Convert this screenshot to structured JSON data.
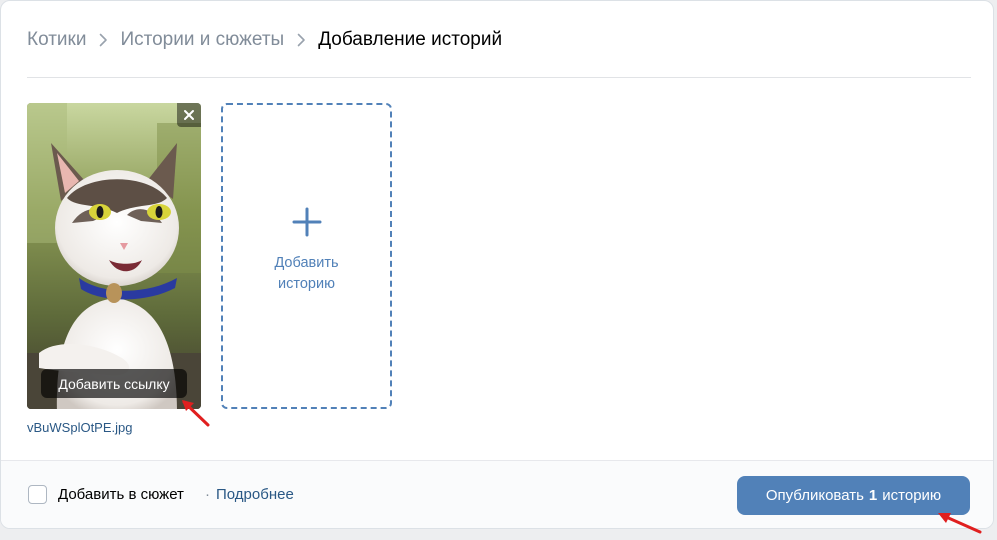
{
  "breadcrumb": {
    "items": [
      "Котики",
      "Истории и сюжеты"
    ],
    "current": "Добавление историй"
  },
  "story": {
    "filename": "vBuWSplOtPE.jpg",
    "add_link_label": "Добавить ссылку",
    "close_icon": "close-icon"
  },
  "add_story": {
    "line1": "Добавить",
    "line2": "историю",
    "icon": "plus-icon"
  },
  "footer": {
    "checkbox_label": "Добавить в сюжет",
    "separator": "·",
    "more_link": "Подробнее",
    "publish_prefix": "Опубликовать",
    "publish_count": "1",
    "publish_suffix": "историю"
  },
  "colors": {
    "accent": "#5181b8",
    "link": "#2a5885",
    "annotation_arrow": "#e01f1f"
  }
}
